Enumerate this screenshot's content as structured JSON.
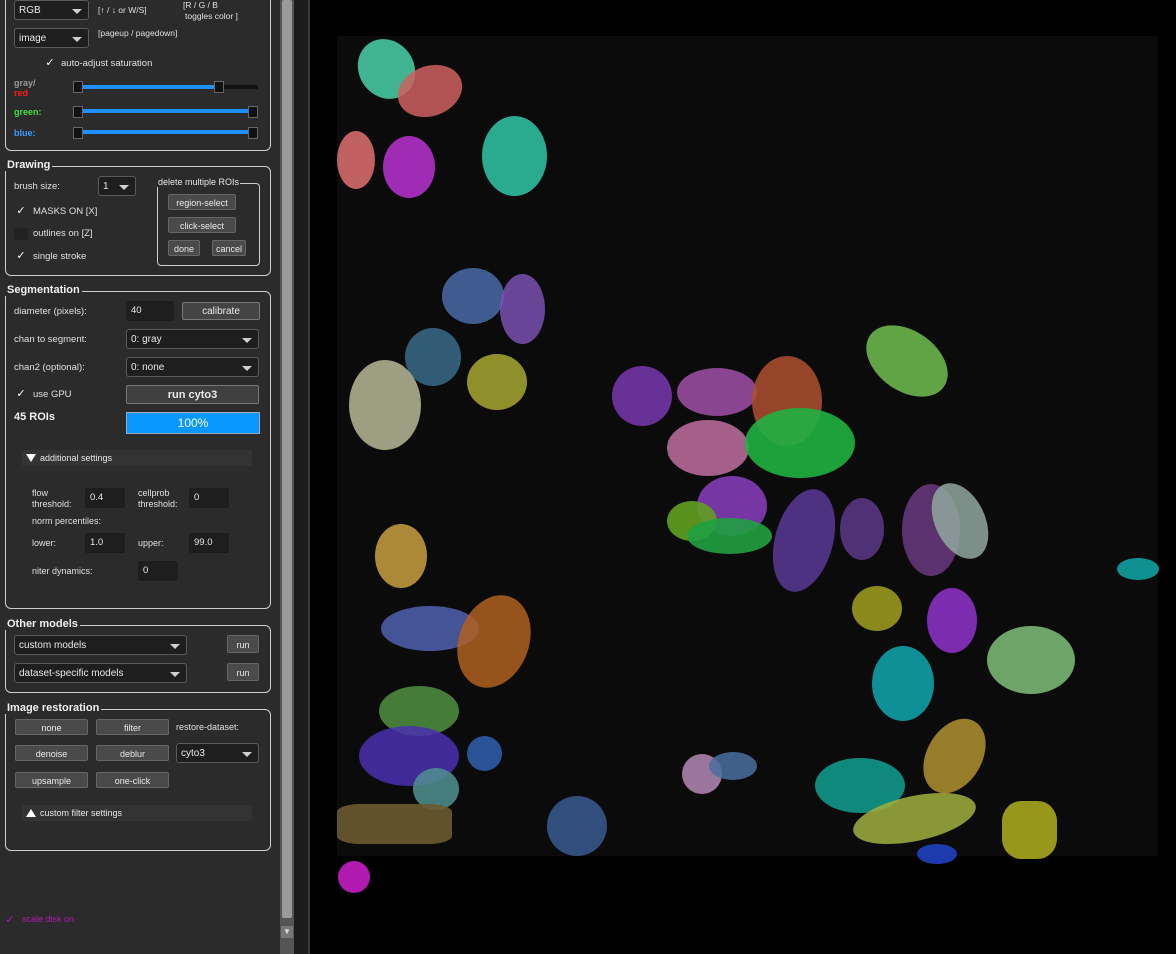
{
  "view": {
    "color_mode": "RGB",
    "color_hint": "[↑ / ↓ or W/S]",
    "rgb_hint_1": "[R / G / B",
    "rgb_hint_2": "toggles color ]",
    "layer": "image",
    "layer_hint": "[pageup / pagedown]",
    "auto_adjust_label": "auto-adjust saturation",
    "auto_adjust_checked": true,
    "gray_label": "gray/",
    "red_label": "red",
    "green_label": "green:",
    "blue_label": "blue:",
    "sliders": {
      "gray_red": [
        0.0,
        0.8
      ],
      "green": [
        0.0,
        1.0
      ],
      "blue": [
        0.0,
        1.0
      ]
    },
    "colors": {
      "red": "#ff1a1a",
      "green": "#40e040",
      "blue": "#3a9cff",
      "gray": "#9a9a9a",
      "accent": "#1e90ff"
    }
  },
  "drawing": {
    "title": "Drawing",
    "brush_label": "brush size:",
    "brush_value": "1",
    "masks_label": "MASKS ON [X]",
    "outlines_label": "outlines on [Z]",
    "single_stroke_label": "single stroke",
    "delete_group_title": "delete multiple ROIs",
    "region_select": "region-select",
    "click_select": "click-select",
    "done": "done",
    "cancel": "cancel"
  },
  "segmentation": {
    "title": "Segmentation",
    "diameter_label": "diameter (pixels):",
    "diameter_value": "40",
    "calibrate": "calibrate",
    "chan_label": "chan to segment:",
    "chan_value": "0: gray",
    "chan2_label": "chan2 (optional):",
    "chan2_value": "0: none",
    "gpu_label": "use GPU",
    "run_button": "run cyto3",
    "roi_count": "45 ROIs",
    "progress_text": "100%",
    "progress": 1.0,
    "additional_label": "additional settings",
    "flow_label_1": "flow",
    "flow_label_2": "threshold:",
    "flow_value": "0.4",
    "cellprob_label_1": "cellprob",
    "cellprob_label_2": "threshold:",
    "cellprob_value": "0",
    "norm_label": "norm percentiles:",
    "lower_label": "lower:",
    "lower_value": "1.0",
    "upper_label": "upper:",
    "upper_value": "99.0",
    "niter_label": "niter dynamics:",
    "niter_value": "0"
  },
  "other_models": {
    "title": "Other models",
    "custom": "custom models",
    "dataset": "dataset-specific models",
    "run1": "run",
    "run2": "run"
  },
  "restoration": {
    "title": "Image restoration",
    "none": "none",
    "filter": "filter",
    "restore_label": "restore-dataset:",
    "denoise": "denoise",
    "deblur": "deblur",
    "dataset_value": "cyto3",
    "upsample": "upsample",
    "oneclick": "one-click",
    "custom_filter": "custom filter settings"
  },
  "footer": {
    "scale_disk_label": "scale disk on",
    "scale_disk_color": "#b01ab0"
  }
}
